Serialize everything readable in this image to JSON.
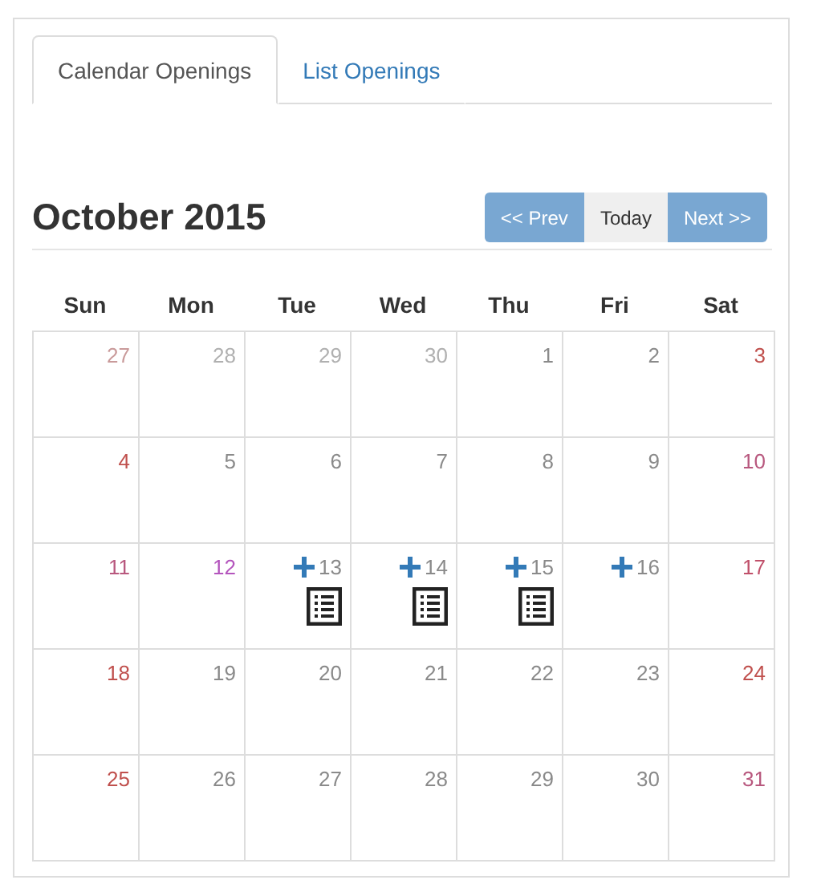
{
  "tabs": [
    {
      "label": "Calendar Openings",
      "selected": true
    },
    {
      "label": "List Openings",
      "selected": false
    }
  ],
  "calendar": {
    "title": "October 2015",
    "nav": [
      {
        "label": "<< Prev",
        "kind": "nav"
      },
      {
        "label": "Today",
        "kind": "today"
      },
      {
        "label": "Next >>",
        "kind": "nav"
      }
    ],
    "weekdays": [
      "Sun",
      "Mon",
      "Tue",
      "Wed",
      "Thu",
      "Fri",
      "Sat"
    ],
    "weeks": [
      [
        {
          "day": "27",
          "color": "#c99a9a",
          "add": false,
          "list": false
        },
        {
          "day": "28",
          "color": "#b0b0b0",
          "add": false,
          "list": false
        },
        {
          "day": "29",
          "color": "#b0b0b0",
          "add": false,
          "list": false
        },
        {
          "day": "30",
          "color": "#b0b0b0",
          "add": false,
          "list": false
        },
        {
          "day": "1",
          "color": "#8a8a8a",
          "add": false,
          "list": false
        },
        {
          "day": "2",
          "color": "#8a8a8a",
          "add": false,
          "list": false
        },
        {
          "day": "3",
          "color": "#c0504d",
          "add": false,
          "list": false
        }
      ],
      [
        {
          "day": "4",
          "color": "#c0504d",
          "add": false,
          "list": false
        },
        {
          "day": "5",
          "color": "#8a8a8a",
          "add": false,
          "list": false
        },
        {
          "day": "6",
          "color": "#8a8a8a",
          "add": false,
          "list": false
        },
        {
          "day": "7",
          "color": "#8a8a8a",
          "add": false,
          "list": false
        },
        {
          "day": "8",
          "color": "#8a8a8a",
          "add": false,
          "list": false
        },
        {
          "day": "9",
          "color": "#8a8a8a",
          "add": false,
          "list": false
        },
        {
          "day": "10",
          "color": "#b8587e",
          "add": false,
          "list": false
        }
      ],
      [
        {
          "day": "11",
          "color": "#b8587e",
          "add": false,
          "list": false
        },
        {
          "day": "12",
          "color": "#b455bd",
          "add": false,
          "list": false
        },
        {
          "day": "13",
          "color": "#8a8a8a",
          "add": true,
          "list": true
        },
        {
          "day": "14",
          "color": "#8a8a8a",
          "add": true,
          "list": true
        },
        {
          "day": "15",
          "color": "#8a8a8a",
          "add": true,
          "list": true
        },
        {
          "day": "16",
          "color": "#8a8a8a",
          "add": true,
          "list": false
        },
        {
          "day": "17",
          "color": "#c0506a",
          "add": false,
          "list": false
        }
      ],
      [
        {
          "day": "18",
          "color": "#c0504d",
          "add": false,
          "list": false
        },
        {
          "day": "19",
          "color": "#8a8a8a",
          "add": false,
          "list": false
        },
        {
          "day": "20",
          "color": "#8a8a8a",
          "add": false,
          "list": false
        },
        {
          "day": "21",
          "color": "#8a8a8a",
          "add": false,
          "list": false
        },
        {
          "day": "22",
          "color": "#8a8a8a",
          "add": false,
          "list": false
        },
        {
          "day": "23",
          "color": "#8a8a8a",
          "add": false,
          "list": false
        },
        {
          "day": "24",
          "color": "#c0504d",
          "add": false,
          "list": false
        }
      ],
      [
        {
          "day": "25",
          "color": "#c0504d",
          "add": false,
          "list": false
        },
        {
          "day": "26",
          "color": "#8a8a8a",
          "add": false,
          "list": false
        },
        {
          "day": "27",
          "color": "#8a8a8a",
          "add": false,
          "list": false
        },
        {
          "day": "28",
          "color": "#8a8a8a",
          "add": false,
          "list": false
        },
        {
          "day": "29",
          "color": "#8a8a8a",
          "add": false,
          "list": false
        },
        {
          "day": "30",
          "color": "#8a8a8a",
          "add": false,
          "list": false
        },
        {
          "day": "31",
          "color": "#b8587e",
          "add": false,
          "list": false
        }
      ]
    ]
  }
}
